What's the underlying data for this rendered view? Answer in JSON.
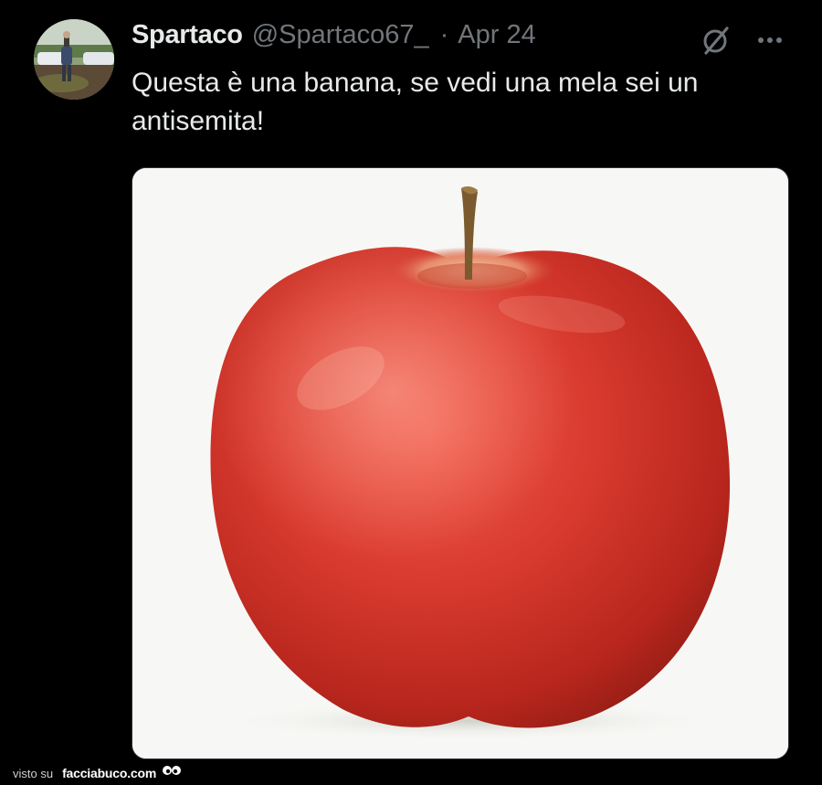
{
  "tweet": {
    "display_name": "Spartaco",
    "handle": "@Spartaco67_",
    "separator": "·",
    "date": "Apr 24",
    "text": "Questa è una banana, se vedi una mela sei un antisemita!",
    "avatar": "avatar-photo",
    "media": "apple-photo"
  },
  "icons": {
    "grok": "grok-icon",
    "more": "more-icon"
  },
  "watermark": {
    "prefix": "visto su",
    "brand": "facciabuco.com",
    "logo": "eyes-logo"
  },
  "colors": {
    "background": "#000000",
    "primary_text": "#e7e9ea",
    "secondary_text": "#71767b",
    "border": "#2f3336",
    "apple_red": "#d83a2e"
  }
}
